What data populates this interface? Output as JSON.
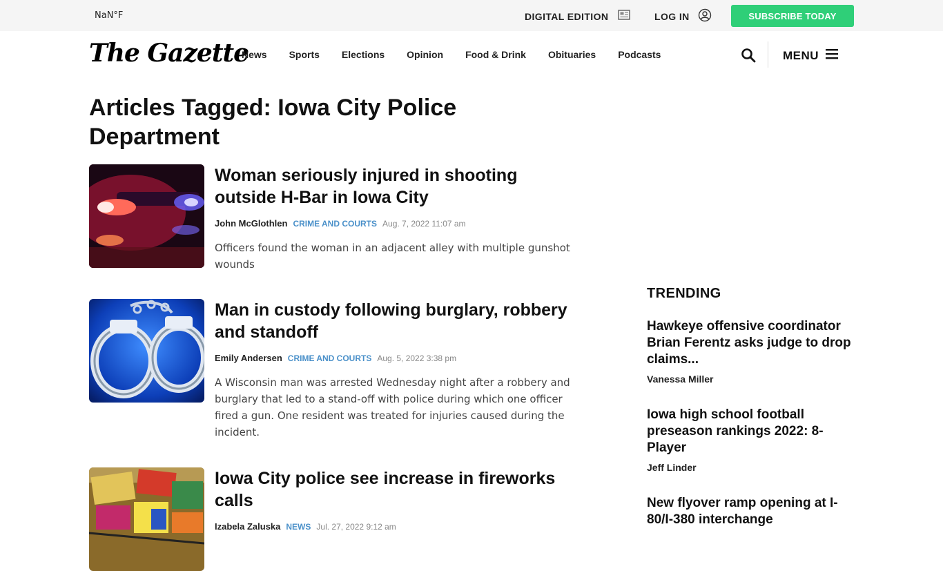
{
  "topbar": {
    "weather": "NaN°F",
    "digital_edition": "DIGITAL EDITION",
    "login": "LOG IN",
    "subscribe": "SUBSCRIBE TODAY"
  },
  "header": {
    "logo": "The Gazette",
    "nav": [
      "News",
      "Sports",
      "Elections",
      "Opinion",
      "Food & Drink",
      "Obituaries",
      "Podcasts"
    ],
    "menu": "MENU"
  },
  "page": {
    "title": "Articles Tagged: Iowa City Police Department"
  },
  "articles": [
    {
      "title": "Woman seriously injured in shooting outside H-Bar in Iowa City",
      "author": "John McGlothlen",
      "category": "CRIME AND COURTS",
      "date": "Aug. 7, 2022 11:07 am",
      "summary": "Officers found the woman in an adjacent alley with multiple gunshot wounds",
      "image": "police-lights"
    },
    {
      "title": "Man in custody following burglary, robbery and standoff",
      "author": "Emily Andersen",
      "category": "CRIME AND COURTS",
      "date": "Aug. 5, 2022 3:38 pm",
      "summary": "A Wisconsin man was arrested Wednesday night after a robbery and burglary that led to a stand-off with police during which one officer fired a gun. One resident was treated for injuries caused during the incident.",
      "image": "handcuffs"
    },
    {
      "title": "Iowa City police see increase in fireworks calls",
      "author": "Izabela Zaluska",
      "category": "NEWS",
      "date": "Jul. 27, 2022 9:12 am",
      "summary": "",
      "image": "fireworks"
    }
  ],
  "trending": {
    "heading": "TRENDING",
    "items": [
      {
        "title": "Hawkeye offensive coordinator Brian Ferentz asks judge to drop claims...",
        "author": "Vanessa Miller"
      },
      {
        "title": "Iowa high school football preseason rankings 2022: 8-Player",
        "author": "Jeff Linder"
      },
      {
        "title": "New flyover ramp opening at I-80/I-380 interchange",
        "author": ""
      }
    ]
  },
  "colors": {
    "subscribe_green": "#2fcf78",
    "category_blue": "#4a90c9",
    "topbar_bg": "#f5f5f5"
  }
}
